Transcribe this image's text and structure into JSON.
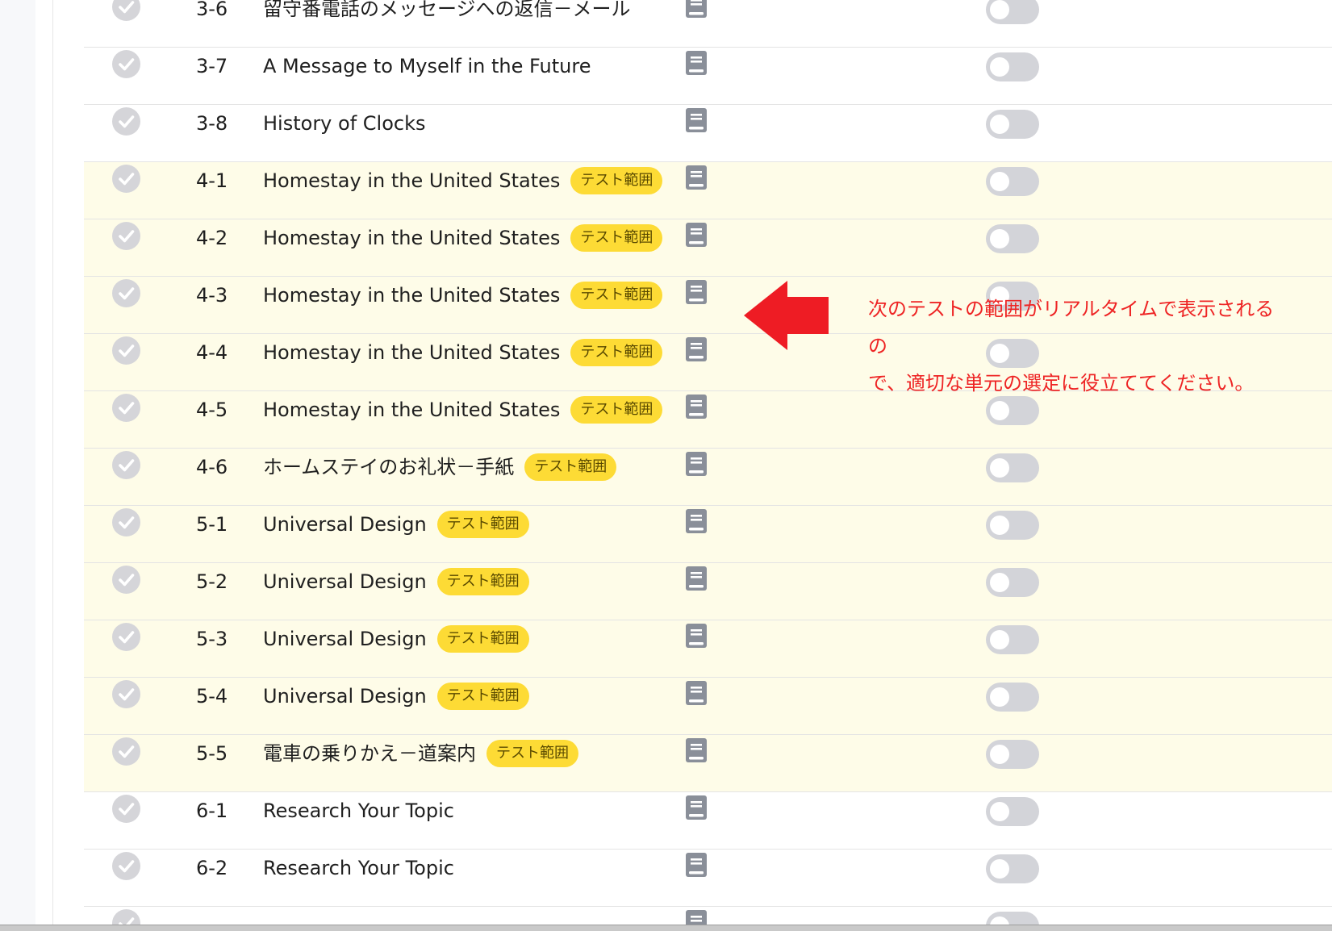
{
  "lessons": [
    {
      "number": "3-6",
      "title": "留守番電話のメッセージへの返信－メール",
      "badge": "",
      "in_range": false
    },
    {
      "number": "3-7",
      "title": "A Message to Myself in the Future",
      "badge": "",
      "in_range": false
    },
    {
      "number": "3-8",
      "title": "History of Clocks",
      "badge": "",
      "in_range": false
    },
    {
      "number": "4-1",
      "title": "Homestay in the United States",
      "badge": "テスト範囲",
      "in_range": true
    },
    {
      "number": "4-2",
      "title": "Homestay in the United States",
      "badge": "テスト範囲",
      "in_range": true
    },
    {
      "number": "4-3",
      "title": "Homestay in the United States",
      "badge": "テスト範囲",
      "in_range": true
    },
    {
      "number": "4-4",
      "title": "Homestay in the United States",
      "badge": "テスト範囲",
      "in_range": true
    },
    {
      "number": "4-5",
      "title": "Homestay in the United States",
      "badge": "テスト範囲",
      "in_range": true
    },
    {
      "number": "4-6",
      "title": "ホームステイのお礼状－手紙",
      "badge": "テスト範囲",
      "in_range": true
    },
    {
      "number": "5-1",
      "title": "Universal Design",
      "badge": "テスト範囲",
      "in_range": true
    },
    {
      "number": "5-2",
      "title": "Universal Design",
      "badge": "テスト範囲",
      "in_range": true
    },
    {
      "number": "5-3",
      "title": "Universal Design",
      "badge": "テスト範囲",
      "in_range": true
    },
    {
      "number": "5-4",
      "title": "Universal Design",
      "badge": "テスト範囲",
      "in_range": true
    },
    {
      "number": "5-5",
      "title": "電車の乗りかえ－道案内",
      "badge": "テスト範囲",
      "in_range": true
    },
    {
      "number": "6-1",
      "title": "Research Your Topic",
      "badge": "",
      "in_range": false
    },
    {
      "number": "6-2",
      "title": "Research Your Topic",
      "badge": "",
      "in_range": false
    },
    {
      "number": "",
      "title": "",
      "badge": "",
      "in_range": false
    }
  ],
  "icons": {
    "status": "check-circle-icon",
    "material": "book-icon",
    "annotation": "red-arrow-left-icon"
  },
  "annotation": {
    "line1": "次のテストの範囲がリアルタイムで表示されるの",
    "line2": "で、適切な単元の選定に役立ててください。"
  },
  "colors": {
    "in_range_row": "#fefce8",
    "badge": "#fddb35",
    "toggle_off": "#d3d4d9",
    "check": "#d5d5d9",
    "book": "#8a8f99",
    "annotation": "#ee2424"
  }
}
